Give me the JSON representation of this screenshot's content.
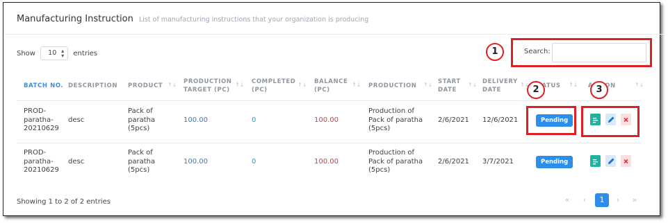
{
  "header": {
    "title": "Manufacturing Instruction",
    "subtitle": "List of manufacturing instructions that your organization is producing"
  },
  "length_menu": {
    "show_label": "Show",
    "value": "10",
    "entries_label": "entries"
  },
  "search": {
    "label": "Search:",
    "value": "",
    "placeholder": ""
  },
  "table": {
    "columns": [
      {
        "key": "batch_no",
        "l1": "BATCH NO.",
        "l2": ""
      },
      {
        "key": "description",
        "l1": "DESCRIPTION",
        "l2": ""
      },
      {
        "key": "product",
        "l1": "PRODUCT",
        "l2": ""
      },
      {
        "key": "production_target",
        "l1": "PRODUCTION",
        "l2": "TARGET (PC)"
      },
      {
        "key": "completed",
        "l1": "COMPLETED",
        "l2": "(PC)"
      },
      {
        "key": "balance",
        "l1": "BALANCE",
        "l2": "(PC)"
      },
      {
        "key": "production",
        "l1": "PRODUCTION",
        "l2": ""
      },
      {
        "key": "start_date",
        "l1": "START",
        "l2": "DATE"
      },
      {
        "key": "delivery_date",
        "l1": "DELIVERY",
        "l2": "DATE"
      },
      {
        "key": "status",
        "l1": "STATUS",
        "l2": ""
      },
      {
        "key": "action",
        "l1": "ACTION",
        "l2": ""
      }
    ],
    "rows": [
      {
        "batch_no": [
          "PROD-",
          "paratha-",
          "20210629"
        ],
        "description": "desc",
        "product": [
          "Pack of",
          "paratha",
          "(5pcs)"
        ],
        "production_target": "100.00",
        "completed": "0",
        "balance": "100.00",
        "production": [
          "Production of",
          "Pack of paratha",
          "(5pcs)"
        ],
        "start_date": "2/6/2021",
        "delivery_date": "12/6/2021",
        "status": "Pending"
      },
      {
        "batch_no": [
          "PROD-",
          "paratha-",
          "20210629"
        ],
        "description": "desc",
        "product": [
          "Pack of",
          "paratha",
          "(5pcs)"
        ],
        "production_target": "100.00",
        "completed": "0",
        "balance": "100.00",
        "production": [
          "Production of",
          "Pack of paratha",
          "(5pcs)"
        ],
        "start_date": "2/6/2021",
        "delivery_date": "3/7/2021",
        "status": "Pending"
      }
    ]
  },
  "footer": {
    "info": "Showing 1 to 2 of 2 entries"
  },
  "pagination": {
    "first": "«",
    "prev": "‹",
    "current": "1",
    "next": "›",
    "last": "»"
  },
  "annotations": [
    "1",
    "2",
    "3"
  ],
  "colors": {
    "accent": "#2d8eea",
    "highlight": "#e01f25",
    "danger": "#e0383a",
    "teal": "#17a5b8"
  },
  "icons": {
    "sort": "sort-icon",
    "view": "document-icon",
    "edit": "edit-icon",
    "delete": "delete-icon"
  }
}
